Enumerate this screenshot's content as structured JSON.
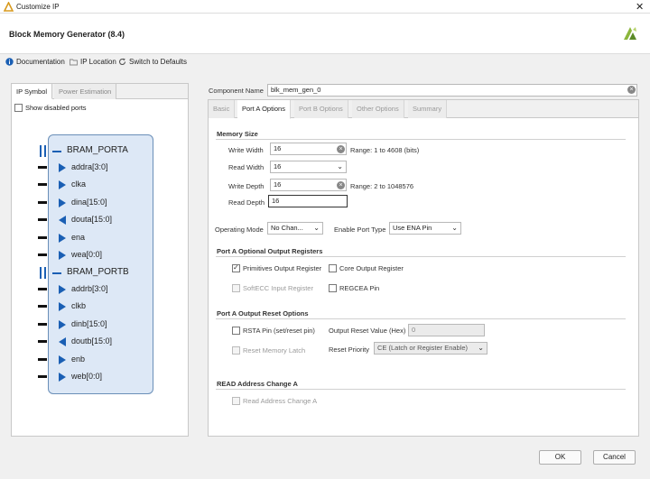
{
  "window": {
    "title": "Customize IP",
    "close": "✕"
  },
  "header": {
    "title": "Block Memory Generator (8.4)"
  },
  "toolbar": {
    "documentation": "Documentation",
    "ip_location": "IP Location",
    "switch_defaults": "Switch to Defaults"
  },
  "left": {
    "tabs": [
      "IP Symbol",
      "Power Estimation"
    ],
    "show_disabled": "Show disabled ports",
    "porta": "BRAM_PORTA",
    "portb": "BRAM_PORTB",
    "pins_a": [
      {
        "label": "addra[3:0]",
        "dir": "in"
      },
      {
        "label": "clka",
        "dir": "in"
      },
      {
        "label": "dina[15:0]",
        "dir": "in"
      },
      {
        "label": "douta[15:0]",
        "dir": "out"
      },
      {
        "label": "ena",
        "dir": "in"
      },
      {
        "label": "wea[0:0]",
        "dir": "in"
      }
    ],
    "pins_b": [
      {
        "label": "addrb[3:0]",
        "dir": "in"
      },
      {
        "label": "clkb",
        "dir": "in"
      },
      {
        "label": "dinb[15:0]",
        "dir": "in"
      },
      {
        "label": "doutb[15:0]",
        "dir": "out"
      },
      {
        "label": "enb",
        "dir": "in"
      },
      {
        "label": "web[0:0]",
        "dir": "in"
      }
    ]
  },
  "component": {
    "label": "Component Name",
    "value": "blk_mem_gen_0"
  },
  "right": {
    "tabs": [
      "Basic",
      "Port A Options",
      "Port B Options",
      "Other Options",
      "Summary"
    ],
    "memory_size": {
      "title": "Memory Size",
      "write_width_label": "Write Width",
      "write_width": "16",
      "write_width_range": "Range: 1 to 4608 (bits)",
      "read_width_label": "Read Width",
      "read_width": "16",
      "write_depth_label": "Write Depth",
      "write_depth": "16",
      "write_depth_range": "Range: 2 to 1048576",
      "read_depth_label": "Read Depth",
      "read_depth": "16"
    },
    "operating_mode_label": "Operating Mode",
    "operating_mode": "No Chan...",
    "enable_port_label": "Enable Port Type",
    "enable_port": "Use ENA Pin",
    "opt_regs": {
      "title": "Port A Optional Output Registers",
      "primitives": "Primitives Output Register",
      "core": "Core Output Register",
      "softecc": "SoftECC Input Register",
      "regcea": "REGCEA Pin"
    },
    "reset": {
      "title": "Port A Output Reset Options",
      "rsta": "RSTA Pin (set/reset pin)",
      "reset_value_label": "Output Reset Value (Hex)",
      "reset_value": "0",
      "reset_latch": "Reset Memory Latch",
      "priority_label": "Reset Priority",
      "priority": "CE (Latch or Register Enable)"
    },
    "read_addr": {
      "title": "READ Address Change A",
      "option": "Read Address Change A"
    }
  },
  "buttons": {
    "ok": "OK",
    "cancel": "Cancel"
  },
  "colors": {
    "accent": "#1a5fb4",
    "symbol_fill": "#dde8f6",
    "brand": "#8cb63c"
  }
}
